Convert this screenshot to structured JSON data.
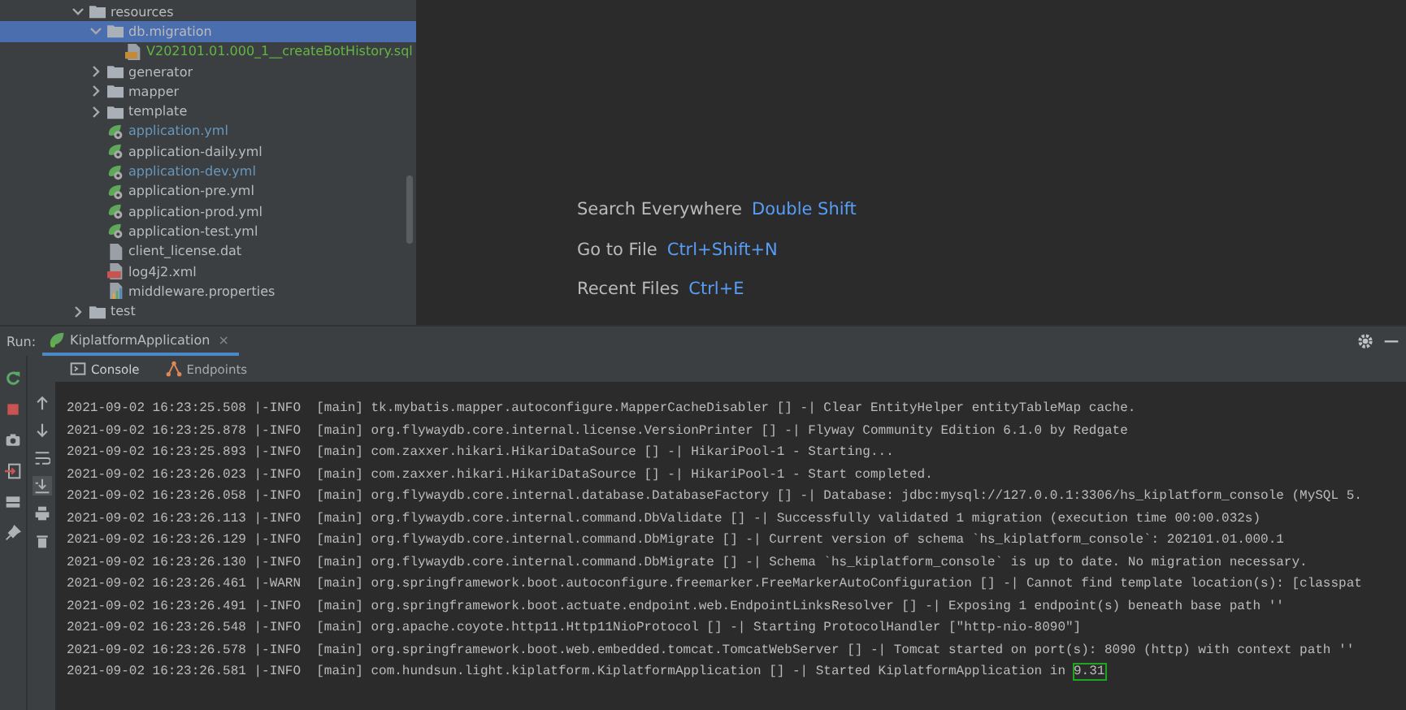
{
  "project_tree": {
    "items": [
      {
        "label": "resources",
        "kind": "folder",
        "expanded": true,
        "selected": false,
        "children": [
          {
            "label": "db.migration",
            "kind": "folder",
            "expanded": true,
            "selected": true,
            "children": [
              {
                "label": "V202101.01.000_1__createBotHistory.sql",
                "kind": "sql",
                "selected": false,
                "color": "#62b543"
              }
            ]
          },
          {
            "label": "generator",
            "kind": "folder",
            "expanded": false,
            "selected": false
          },
          {
            "label": "mapper",
            "kind": "folder",
            "expanded": false,
            "selected": false
          },
          {
            "label": "template",
            "kind": "folder",
            "expanded": false,
            "selected": false
          },
          {
            "label": "application.yml",
            "kind": "yaml",
            "selected": false,
            "color": "#6897bb"
          },
          {
            "label": "application-daily.yml",
            "kind": "yaml",
            "selected": false
          },
          {
            "label": "application-dev.yml",
            "kind": "yaml",
            "selected": false,
            "color": "#6897bb"
          },
          {
            "label": "application-pre.yml",
            "kind": "yaml",
            "selected": false
          },
          {
            "label": "application-prod.yml",
            "kind": "yaml",
            "selected": false
          },
          {
            "label": "application-test.yml",
            "kind": "yaml",
            "selected": false
          },
          {
            "label": "client_license.dat",
            "kind": "file",
            "selected": false
          },
          {
            "label": "log4j2.xml",
            "kind": "xml",
            "selected": false
          },
          {
            "label": "middleware.properties",
            "kind": "properties",
            "selected": false
          }
        ]
      },
      {
        "label": "test",
        "kind": "folder",
        "expanded": false,
        "selected": false
      }
    ]
  },
  "editor_hints": [
    {
      "label": "Search Everywhere",
      "shortcut": "Double Shift"
    },
    {
      "label": "Go to File",
      "shortcut": "Ctrl+Shift+N"
    },
    {
      "label": "Recent Files",
      "shortcut": "Ctrl+E"
    }
  ],
  "run_panel": {
    "title": "Run:",
    "tab": "KiplatformApplication",
    "close": "×",
    "subtabs": [
      {
        "label": "Console",
        "kind": "console",
        "selected": true
      },
      {
        "label": "Endpoints",
        "kind": "endpoints",
        "selected": false
      }
    ],
    "log_lines": [
      {
        "text": "2021-09-02 16:23:25.508 |-INFO  [main] tk.mybatis.mapper.autoconfigure.MapperCacheDisabler [] -| Clear EntityHelper entityTableMap cache."
      },
      {
        "text": "2021-09-02 16:23:25.878 |-INFO  [main] org.flywaydb.core.internal.license.VersionPrinter [] -| Flyway Community Edition 6.1.0 by Redgate"
      },
      {
        "text": "2021-09-02 16:23:25.893 |-INFO  [main] com.zaxxer.hikari.HikariDataSource [] -| HikariPool-1 - Starting..."
      },
      {
        "text": "2021-09-02 16:23:26.023 |-INFO  [main] com.zaxxer.hikari.HikariDataSource [] -| HikariPool-1 - Start completed."
      },
      {
        "text": "2021-09-02 16:23:26.058 |-INFO  [main] org.flywaydb.core.internal.database.DatabaseFactory [] -| Database: jdbc:mysql://127.0.0.1:3306/hs_kiplatform_console (MySQL 5."
      },
      {
        "text": "2021-09-02 16:23:26.113 |-INFO  [main] org.flywaydb.core.internal.command.DbValidate [] -| Successfully validated 1 migration (execution time 00:00.032s)"
      },
      {
        "text": "2021-09-02 16:23:26.129 |-INFO  [main] org.flywaydb.core.internal.command.DbMigrate [] -| Current version of schema `hs_kiplatform_console`: 202101.01.000.1"
      },
      {
        "text": "2021-09-02 16:23:26.130 |-INFO  [main] org.flywaydb.core.internal.command.DbMigrate [] -| Schema `hs_kiplatform_console` is up to date. No migration necessary."
      },
      {
        "text": "2021-09-02 16:23:26.461 |-WARN  [main] org.springframework.boot.autoconfigure.freemarker.FreeMarkerAutoConfiguration [] -| Cannot find template location(s): [classpat"
      },
      {
        "text": "2021-09-02 16:23:26.491 |-INFO  [main] org.springframework.boot.actuate.endpoint.web.EndpointLinksResolver [] -| Exposing 1 endpoint(s) beneath base path ''"
      },
      {
        "text": "2021-09-02 16:23:26.548 |-INFO  [main] org.apache.coyote.http11.Http11NioProtocol [] -| Starting ProtocolHandler [\"http-nio-8090\"]"
      },
      {
        "text": "2021-09-02 16:23:26.578 |-INFO  [main] org.springframework.boot.web.embedded.tomcat.TomcatWebServer [] -| Tomcat started on port(s): 8090 (http) with context path ''"
      },
      {
        "text": "2021-09-02 16:23:26.581 |-INFO  [main] com.hundsun.light.kiplatform.KiplatformApplication [] -| Started KiplatformApplication in",
        "highlight": "9.31"
      }
    ]
  }
}
